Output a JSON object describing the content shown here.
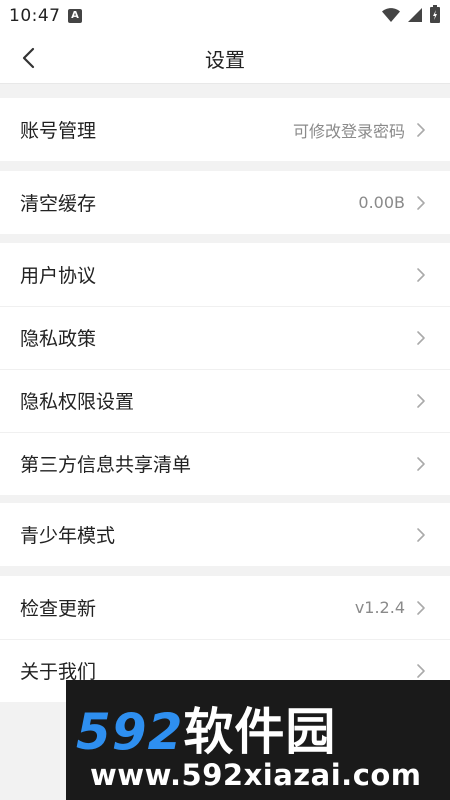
{
  "status_bar": {
    "time": "10:47",
    "notification_letter": "A"
  },
  "nav": {
    "title": "设置"
  },
  "groups": [
    {
      "items": [
        {
          "label": "账号管理",
          "value": "可修改登录密码"
        }
      ]
    },
    {
      "items": [
        {
          "label": "清空缓存",
          "value": "0.00B"
        }
      ]
    },
    {
      "items": [
        {
          "label": "用户协议",
          "value": ""
        },
        {
          "label": "隐私政策",
          "value": ""
        },
        {
          "label": "隐私权限设置",
          "value": ""
        },
        {
          "label": "第三方信息共享清单",
          "value": ""
        }
      ]
    },
    {
      "items": [
        {
          "label": "青少年模式",
          "value": ""
        }
      ]
    },
    {
      "items": [
        {
          "label": "检查更新",
          "value": "v1.2.4"
        },
        {
          "label": "关于我们",
          "value": ""
        }
      ]
    }
  ],
  "watermark": {
    "number": "592",
    "brand": "软件园",
    "url": "www.592xiazai.com"
  },
  "colors": {
    "background": "#f2f2f2",
    "card": "#ffffff",
    "text": "#222222",
    "secondary_text": "#8a8a8a",
    "watermark_blue": "#2e8ff0"
  }
}
